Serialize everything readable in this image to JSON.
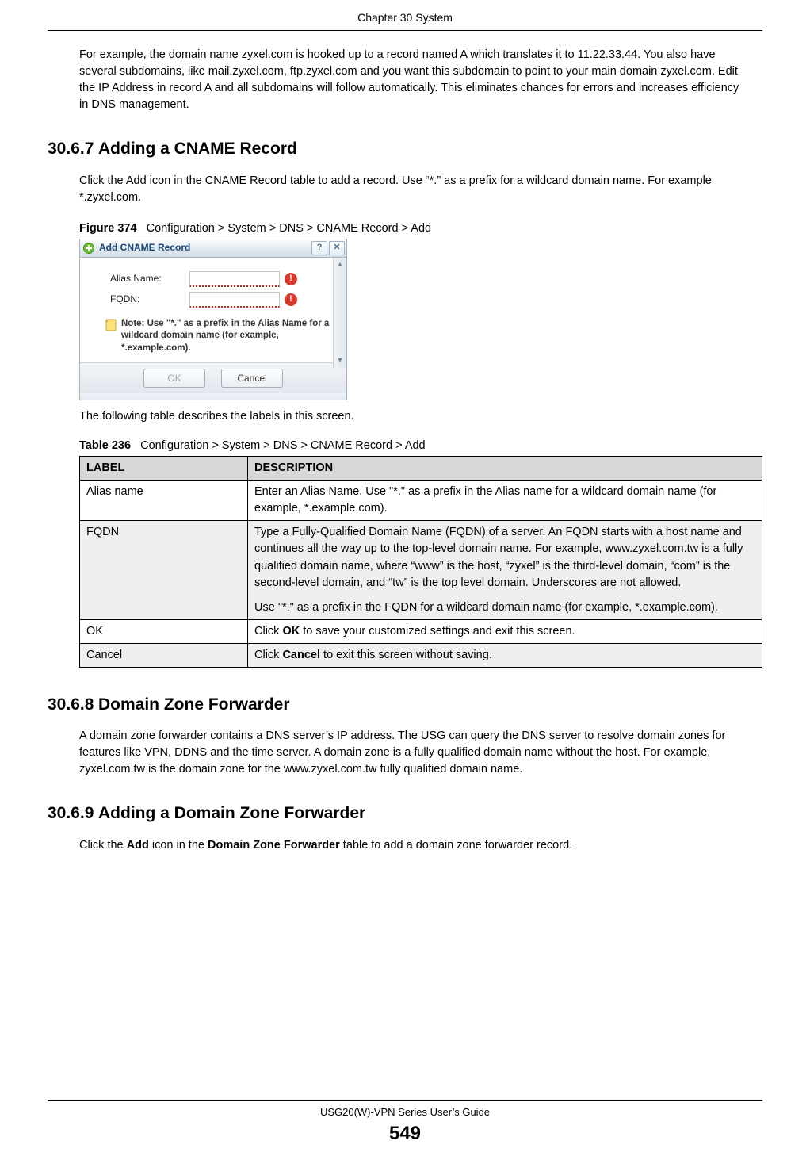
{
  "chapter_header": "Chapter 30 System",
  "intro_para": "For example, the domain name zyxel.com is hooked up to a record named A which translates it to 11.22.33.44. You also have several subdomains, like mail.zyxel.com, ftp.zyxel.com and you want this subdomain to point to your main domain zyxel.com. Edit the IP Address in record A and all subdomains will follow automatically. This eliminates chances for errors and increases efficiency in DNS management.",
  "sec3067": {
    "num": "30.6.7",
    "title": "Adding a CNAME Record",
    "para": "Click the Add icon in the CNAME Record table to add a record. Use “*.” as a prefix for a wildcard domain name. For example *.zyxel.com."
  },
  "figure374": {
    "label": "Figure 374",
    "caption": "Configuration > System > DNS > CNAME Record > Add"
  },
  "dialog": {
    "title": "Add CNAME Record",
    "alias_label": "Alias Name:",
    "fqdn_label": "FQDN:",
    "note": "Note: Use \"*.\" as a prefix in the Alias Name for a wildcard domain name (for example, *.example.com).",
    "ok": "OK",
    "cancel": "Cancel",
    "help_glyph": "?",
    "close_glyph": "✕",
    "error_glyph": "!"
  },
  "table_intro": "The following table describes the labels in this screen.",
  "table236": {
    "label": "Table 236",
    "caption": "Configuration > System > DNS > CNAME Record > Add",
    "head_label": "LABEL",
    "head_desc": "DESCRIPTION",
    "rows": {
      "alias": {
        "label": "Alias name",
        "desc": "Enter an Alias Name. Use \"*.\" as a prefix in the Alias name for a wildcard domain name (for example, *.example.com)."
      },
      "fqdn": {
        "label": "FQDN",
        "p1": "Type a Fully-Qualified Domain Name (FQDN) of a server. An FQDN starts with a host name and continues all the way up to the top-level domain name. For example, www.zyxel.com.tw is a fully qualified domain name, where “www” is the host, “zyxel” is the third-level domain, “com” is the second-level domain, and “tw” is the top level domain. Underscores are not allowed.",
        "p2": "Use \"*.\" as a prefix in the FQDN for a wildcard domain name (for example, *.example.com)."
      },
      "ok": {
        "label": "OK",
        "pre": "Click ",
        "bold": "OK",
        "post": " to save your customized settings and exit this screen."
      },
      "cancel": {
        "label": "Cancel",
        "pre": "Click ",
        "bold": "Cancel",
        "post": " to exit this screen without saving."
      }
    }
  },
  "sec3068": {
    "num": "30.6.8",
    "title": "Domain Zone Forwarder",
    "para": "A domain zone forwarder contains a DNS server’s IP address. The USG can query the DNS server to resolve domain zones for features like VPN, DDNS and the time server. A domain zone is a fully qualified domain name without the host. For example, zyxel.com.tw is the domain zone for the www.zyxel.com.tw fully qualified domain name."
  },
  "sec3069": {
    "num": "30.6.9",
    "title": "Adding a Domain Zone Forwarder",
    "pre": "Click the ",
    "b1": "Add",
    "mid": " icon in the ",
    "b2": "Domain Zone Forwarder",
    "post": " table to add a domain zone forwarder record."
  },
  "footer": {
    "guide": "USG20(W)-VPN Series User’s Guide",
    "page_num": "549"
  }
}
